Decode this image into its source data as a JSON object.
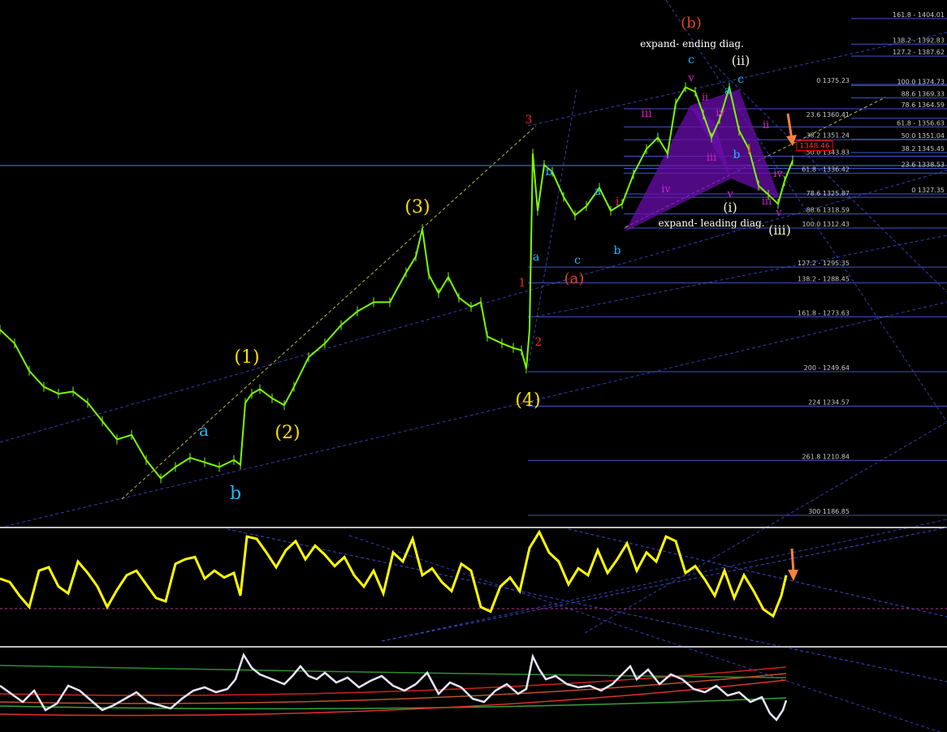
{
  "colors": {
    "background": "#000000",
    "price_bars": "#7CFC00",
    "oscillator": "#FFFF00",
    "lower_line": "#E6E6FA",
    "fib_lines": "#4B5FD8",
    "channel": "#3C48C8",
    "pattern_fill": "#6A0DAD",
    "arrow": "#FF8040",
    "current_price_box": "#FF0000",
    "wave_yellow": "#FFE100",
    "wave_cyan": "#22B8FF",
    "wave_red": "#FF2020",
    "wave_orange": "#E2481A",
    "wave_magenta": "#D020D0",
    "wave_white": "#EFEFD0"
  },
  "chart_data": [
    {
      "type": "line",
      "panel": "price",
      "ylim": [
        1180,
        1410
      ],
      "series": [
        {
          "x": [
            0,
            18,
            36,
            54,
            72,
            90,
            108,
            126,
            144,
            162,
            180,
            198,
            216,
            234,
            252,
            270,
            288,
            296,
            302,
            310,
            320,
            335,
            350,
            362,
            380,
            400,
            420,
            440,
            460,
            480,
            500,
            512,
            520,
            528,
            540,
            552,
            565,
            580,
            592,
            600,
            618,
            632,
            642,
            648,
            652,
            656,
            662,
            670,
            680,
            694,
            708,
            722,
            738,
            752,
            766,
            780,
            796,
            810,
            822,
            832,
            844,
            856,
            866,
            876,
            886,
            898,
            910,
            922,
            934,
            946,
            958,
            966,
            976
          ],
          "values": [
            1268,
            1262,
            1250,
            1243,
            1240,
            1241,
            1236,
            1228,
            1220,
            1222,
            1211,
            1203,
            1208,
            1212,
            1210,
            1208,
            1211,
            1209,
            1236,
            1240,
            1242,
            1238,
            1235,
            1243,
            1256,
            1262,
            1270,
            1276,
            1280,
            1280,
            1293,
            1300,
            1312,
            1292,
            1284,
            1291,
            1282,
            1278,
            1280,
            1265,
            1262,
            1260,
            1259,
            1251,
            1268,
            1345,
            1320,
            1340,
            1337,
            1326,
            1318,
            1322,
            1330,
            1320,
            1323,
            1336,
            1347,
            1352,
            1345,
            1367,
            1374,
            1372,
            1362,
            1352,
            1360,
            1374,
            1355,
            1347,
            1331,
            1327,
            1323,
            1333,
            1342
          ]
        }
      ],
      "fib_levels": [
        {
          "label": "161.8 - 1404.01",
          "value": 1404.01
        },
        {
          "label": "138.2 - 1392.83",
          "value": 1392.83
        },
        {
          "label": "127.2 - 1387.62",
          "value": 1387.62
        },
        {
          "label": "0 1375.23",
          "value": 1375.23
        },
        {
          "label": "100.0 1374.73",
          "value": 1374.73
        },
        {
          "label": "88.6 1369.33",
          "value": 1369.33
        },
        {
          "label": "78.6 1364.59",
          "value": 1364.59
        },
        {
          "label": "23.6 1360.41",
          "value": 1360.41
        },
        {
          "label": "61.8 - 1356.63",
          "value": 1356.63
        },
        {
          "label": "38.2 1351.24",
          "value": 1351.24
        },
        {
          "label": "50.0 1351.04",
          "value": 1351.04
        },
        {
          "label": "38.2 1345.45",
          "value": 1345.45
        },
        {
          "label": "50.0 1343.83",
          "value": 1343.83
        },
        {
          "label": "23.6 1338.53",
          "value": 1338.53
        },
        {
          "label": "61.8 - 1336.42",
          "value": 1336.42
        },
        {
          "label": "0 1327.35",
          "value": 1327.35
        },
        {
          "label": "78.6 1325.87",
          "value": 1325.87
        },
        {
          "label": "88.6 1318.59",
          "value": 1318.59
        },
        {
          "label": "100.0 1312.43",
          "value": 1312.43
        },
        {
          "label": "127.2 - 1295.35",
          "value": 1295.35
        },
        {
          "label": "138.2 - 1288.45",
          "value": 1288.45
        },
        {
          "label": "161.8 - 1273.63",
          "value": 1273.63
        },
        {
          "label": "200 - 1249.64",
          "value": 1249.64
        },
        {
          "label": "224 1234.57",
          "value": 1234.57
        },
        {
          "label": "261.8 1210.84",
          "value": 1210.84
        },
        {
          "label": "300 1186.85",
          "value": 1186.85
        }
      ],
      "current_price": "1348.46",
      "annotations": [
        "expand- ending diag.",
        "expand- leading diag."
      ],
      "wave_labels": [
        {
          "text": "(1)",
          "color": "yellow"
        },
        {
          "text": "(2)",
          "color": "yellow"
        },
        {
          "text": "(3)",
          "color": "yellow"
        },
        {
          "text": "(4)",
          "color": "yellow"
        },
        {
          "text": "a",
          "color": "cyan"
        },
        {
          "text": "b",
          "color": "cyan"
        },
        {
          "text": "3",
          "color": "red"
        },
        {
          "text": "1",
          "color": "red"
        },
        {
          "text": "2",
          "color": "red"
        },
        {
          "text": "(a)",
          "color": "orange"
        },
        {
          "text": "(b)",
          "color": "orange"
        },
        {
          "text": "b",
          "color": "cyan"
        },
        {
          "text": "a",
          "color": "cyan"
        },
        {
          "text": "c",
          "color": "cyan"
        },
        {
          "text": "a",
          "color": "cyan"
        },
        {
          "text": "b",
          "color": "cyan"
        },
        {
          "text": "c",
          "color": "cyan"
        },
        {
          "text": "a",
          "color": "cyan"
        },
        {
          "text": "c",
          "color": "cyan"
        },
        {
          "text": "b",
          "color": "cyan"
        },
        {
          "text": "i",
          "color": "red"
        },
        {
          "text": "i",
          "color": "red"
        },
        {
          "text": "iii",
          "color": "magenta"
        },
        {
          "text": "iv",
          "color": "magenta"
        },
        {
          "text": "v",
          "color": "magenta"
        },
        {
          "text": "ii",
          "color": "magenta"
        },
        {
          "text": "iii",
          "color": "magenta"
        },
        {
          "text": "iv",
          "color": "magenta"
        },
        {
          "text": "v",
          "color": "magenta"
        },
        {
          "text": "ii",
          "color": "magenta"
        },
        {
          "text": "iii",
          "color": "magenta"
        },
        {
          "text": "iv",
          "color": "magenta"
        },
        {
          "text": "v",
          "color": "magenta"
        },
        {
          "text": "(i)",
          "color": "white"
        },
        {
          "text": "(ii)",
          "color": "white"
        },
        {
          "text": "(iii)",
          "color": "white"
        }
      ]
    },
    {
      "type": "line",
      "panel": "oscillator",
      "series": [
        {
          "x": [
            0,
            12,
            24,
            36,
            48,
            60,
            72,
            84,
            96,
            108,
            120,
            132,
            144,
            156,
            168,
            180,
            192,
            204,
            216,
            228,
            240,
            252,
            264,
            276,
            288,
            296,
            304,
            316,
            328,
            340,
            352,
            364,
            376,
            388,
            400,
            412,
            424,
            436,
            448,
            460,
            472,
            484,
            496,
            508,
            520,
            532,
            544,
            556,
            568,
            580,
            592,
            604,
            616,
            628,
            640,
            652,
            664,
            676,
            688,
            700,
            712,
            724,
            736,
            748,
            760,
            772,
            784,
            796,
            808,
            820,
            832,
            844,
            856,
            868,
            880,
            892,
            904,
            916,
            928,
            940,
            952,
            962,
            968
          ],
          "values": [
            55,
            52,
            40,
            30,
            62,
            65,
            48,
            42,
            70,
            60,
            48,
            30,
            45,
            58,
            62,
            50,
            38,
            35,
            68,
            72,
            74,
            55,
            62,
            56,
            60,
            40,
            92,
            90,
            78,
            65,
            80,
            88,
            72,
            84,
            76,
            66,
            74,
            58,
            48,
            62,
            42,
            78,
            70,
            90,
            58,
            64,
            52,
            44,
            68,
            62,
            30,
            26,
            48,
            56,
            44,
            82,
            96,
            78,
            70,
            50,
            64,
            58,
            80,
            60,
            72,
            86,
            62,
            78,
            70,
            92,
            88,
            60,
            66,
            54,
            40,
            62,
            38,
            58,
            44,
            28,
            22,
            40,
            58
          ]
        }
      ]
    },
    {
      "type": "line",
      "panel": "lower_indicator",
      "series": [
        {
          "x": [
            0,
            14,
            28,
            42,
            56,
            70,
            84,
            98,
            112,
            126,
            140,
            154,
            168,
            182,
            196,
            210,
            224,
            238,
            252,
            266,
            280,
            290,
            300,
            310,
            320,
            330,
            340,
            350,
            360,
            370,
            380,
            390,
            400,
            414,
            428,
            442,
            456,
            470,
            484,
            498,
            512,
            526,
            540,
            554,
            568,
            582,
            596,
            610,
            624,
            638,
            648,
            656,
            664,
            672,
            684,
            698,
            712,
            726,
            740,
            754,
            768,
            776,
            784,
            798,
            812,
            826,
            840,
            854,
            868,
            882,
            896,
            910,
            924,
            938,
            948,
            956,
            964,
            968
          ],
          "values": [
            50,
            40,
            30,
            44,
            20,
            28,
            50,
            44,
            32,
            20,
            26,
            34,
            42,
            30,
            26,
            22,
            34,
            44,
            48,
            42,
            46,
            58,
            88,
            72,
            64,
            60,
            56,
            52,
            62,
            74,
            62,
            58,
            66,
            54,
            60,
            48,
            56,
            62,
            50,
            44,
            52,
            66,
            40,
            54,
            48,
            34,
            30,
            44,
            52,
            40,
            46,
            86,
            70,
            58,
            62,
            52,
            48,
            50,
            44,
            52,
            66,
            74,
            58,
            70,
            52,
            64,
            58,
            46,
            42,
            50,
            38,
            42,
            30,
            36,
            16,
            8,
            20,
            32
          ]
        }
      ]
    }
  ]
}
